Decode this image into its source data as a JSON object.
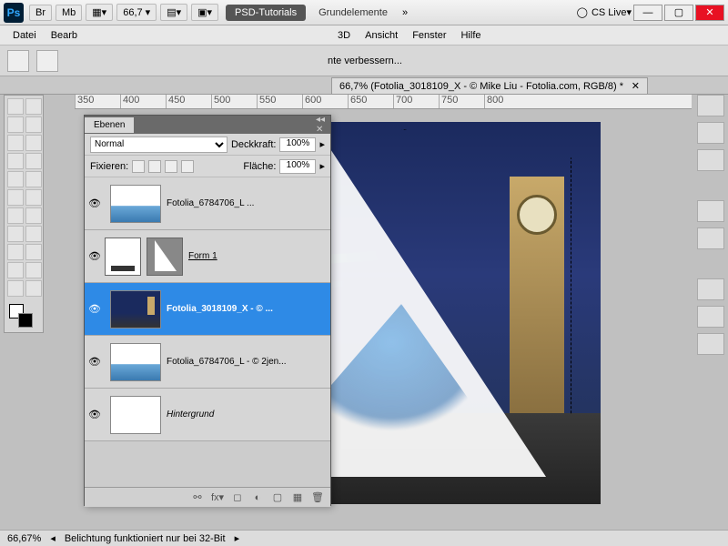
{
  "titlebar": {
    "ps": "Ps",
    "br": "Br",
    "mb": "Mb",
    "zoom": "66,7",
    "psd_tutorials": "PSD-Tutorials",
    "grundelemente": "Grundelemente",
    "cslive": "CS Live"
  },
  "menu": {
    "datei": "Datei",
    "bearb": "Bearb",
    "3d": "3D",
    "ansicht": "Ansicht",
    "fenster": "Fenster",
    "hilfe": "Hilfe"
  },
  "optionsbar": {
    "verbessern": "nte verbessern..."
  },
  "doctab": {
    "title": "66,7% (Fotolia_3018109_X - © Mike Liu - Fotolia.com, RGB/8) *"
  },
  "ruler": [
    "350",
    "400",
    "450",
    "500",
    "550",
    "600",
    "650",
    "700",
    "750",
    "800"
  ],
  "layers_panel": {
    "tab": "Ebenen",
    "blend_mode": "Normal",
    "deckkraft_label": "Deckkraft:",
    "deckkraft_value": "100%",
    "fixieren_label": "Fixieren:",
    "flaeche_label": "Fläche:",
    "flaeche_value": "100%",
    "layers": [
      {
        "name": "Fotolia_6784706_L ...",
        "thumb": "water-th",
        "mask": "",
        "underline": false
      },
      {
        "name": "Form 1",
        "thumb": "",
        "mask": "tri",
        "vec": true,
        "underline": true
      },
      {
        "name": "Fotolia_3018109_X - © ...",
        "thumb": "night-th",
        "selected": true
      },
      {
        "name": "Fotolia_6784706_L - © 2jen...",
        "thumb": "water-th"
      },
      {
        "name": "Hintergrund",
        "thumb": "white-th",
        "italic": true
      }
    ]
  },
  "statusbar": {
    "zoom": "66,67%",
    "info": "Belichtung funktioniert nur bei 32-Bit"
  }
}
